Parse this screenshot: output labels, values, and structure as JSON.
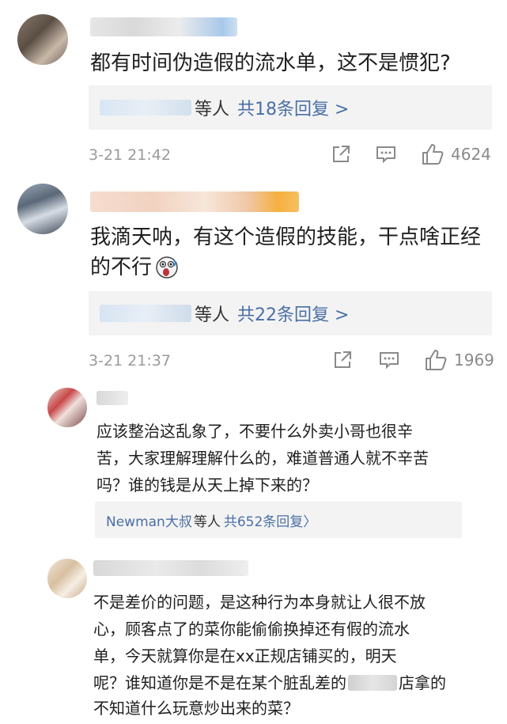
{
  "comments": [
    {
      "text_lines": [
        "都有时间伪造假的流水单，这不是惯犯?"
      ],
      "reply_summary": {
        "people_suffix": "等人",
        "count_text": "共18条回复 >"
      },
      "time": "3-21 21:42",
      "likes": "4624"
    },
    {
      "text_lines": [
        "我滴天呐，有这个造假的技能，干点啥正经",
        "的不行"
      ],
      "reply_summary": {
        "people_suffix": "等人",
        "count_text": "共22条回复 >"
      },
      "time": "3-21 21:37",
      "likes": "1969"
    },
    {
      "text_lines": [
        "应该整治这乱象了，不要什么外卖小哥也很辛",
        "苦，大家理解理解什么的，难道普通人就不辛苦",
        "吗？谁的钱是从天上掉下来的？"
      ],
      "reply_summary": {
        "lead_name": "Newman大叔",
        "people_suffix": "等人",
        "count_text": "共652条回复〉"
      }
    },
    {
      "text_lines": [
        "不是差价的问题，是这种行为本身就让人很不放",
        "心，顾客点了的菜你能偷偷换掉还有假的流水",
        "单，今天就算你是在xx正规店铺买的，明天",
        "呢？谁知道你是不是在某个脏乱差的",
        "店拿的",
        "不知道什么玩意炒出来的菜？"
      ]
    }
  ],
  "icons": {
    "share": "share-icon",
    "comment": "comment-icon",
    "like": "thumbs-up-icon",
    "emoji": "shocked-emoji-icon"
  },
  "colors": {
    "link": "#4a6fa5",
    "meta": "#9a9a9a",
    "reply_bg": "#f3f3f3"
  }
}
